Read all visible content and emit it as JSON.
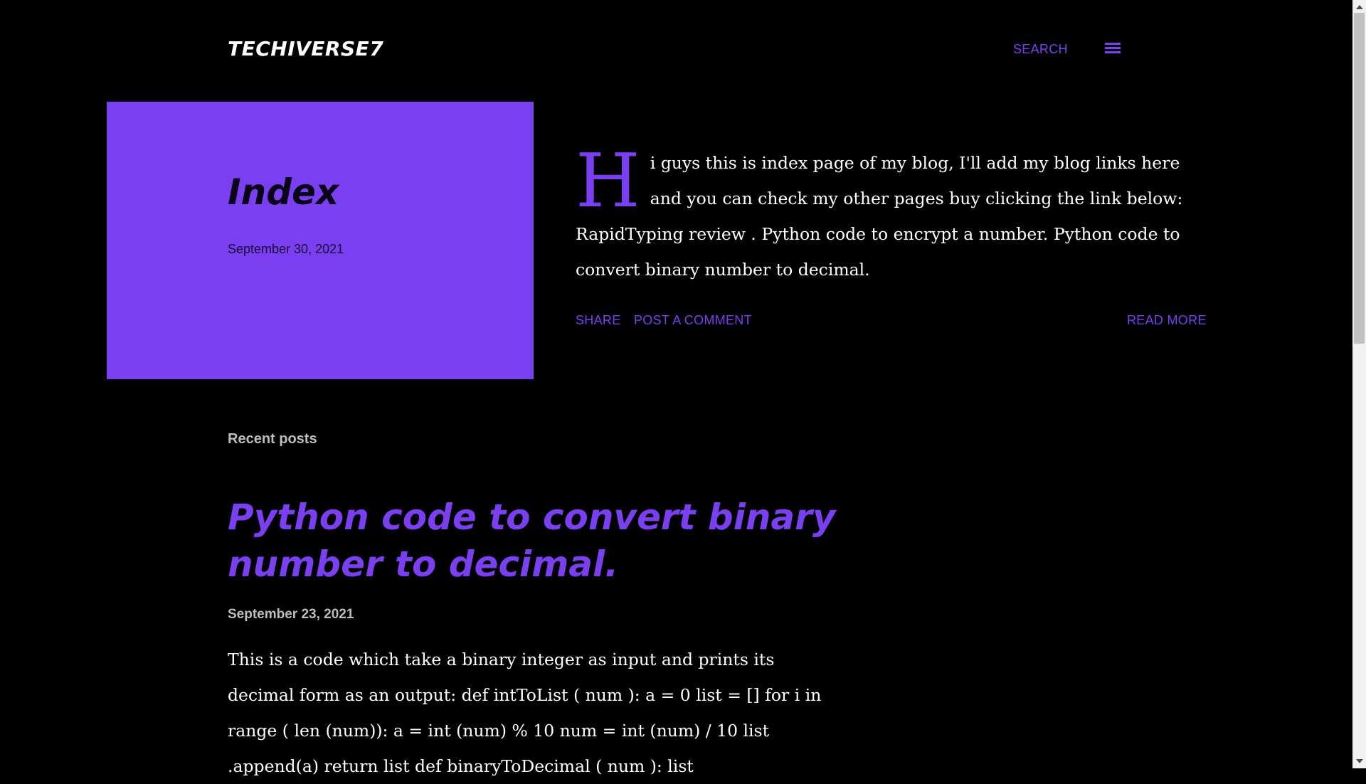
{
  "header": {
    "brand": "TECHIVERSE7",
    "search_label": "SEARCH",
    "menu_icon": "hamburger-menu-icon"
  },
  "featured": {
    "title": "Index",
    "date": "September 30, 2021",
    "dropcap": "H",
    "body": "i guys this is index page of my blog, I'll add my blog links here and you can check my other pages buy clicking the link below: RapidTyping review . Python code to encrypt a number. Python code to convert binary number to decimal.",
    "share_label": "SHARE",
    "comment_label": "POST A COMMENT",
    "read_more_label": "READ MORE",
    "card_color": "#7b3ff2"
  },
  "recent": {
    "heading": "Recent posts",
    "posts": [
      {
        "title": "Python code to convert binary number to decimal.",
        "date": "September 23, 2021",
        "snippet": "This is a code which take a binary integer as input and prints its decimal form as an output:  def   intToList ( num ):      a  =   0      list   =  []      for  i in   range ( len (num)):          a  =   int (num) % 10          num =   int (num) / 10          list .append(a)      return   list def   binaryToDecimal ( num ):       list"
      }
    ]
  },
  "colors": {
    "accent": "#7b3ff2",
    "background": "#000000",
    "text": "#ffffff",
    "muted": "#bdbdbd"
  }
}
